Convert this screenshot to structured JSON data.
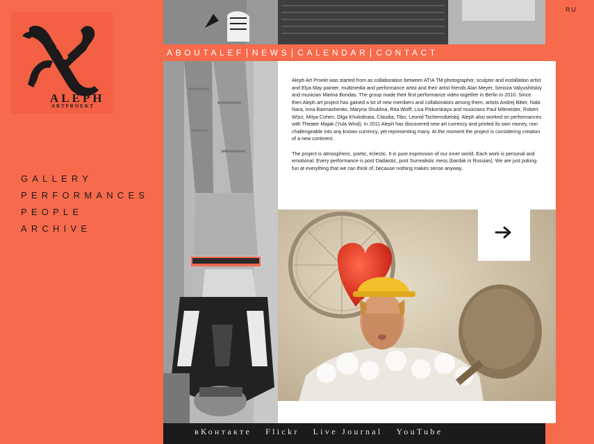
{
  "logo": {
    "word": "ALEPH",
    "sub": "ARTPROEKT"
  },
  "lang": "RU",
  "side_nav": {
    "items": [
      {
        "label": "Gallery"
      },
      {
        "label": "Performances"
      },
      {
        "label": "People"
      },
      {
        "label": "Archive"
      }
    ]
  },
  "top_nav": {
    "items": [
      {
        "label": "AboutAlef"
      },
      {
        "label": "News"
      },
      {
        "label": "Calendar"
      },
      {
        "label": "Contact"
      }
    ]
  },
  "article": {
    "paragraph1": "Aleph Art Proekt was started from as collaboration between ATIA TM photographer, sculptor and installation artist and Elya May painter, multimedia and performance artist and their artist friends Alan Meyer, Serioza Valyushitskiy and musician Marina Bondas. The group made their first performance video together in Berlin in 2010. Since then Aleph art project has gained a lot of new members and collaborators among them, artists Andrej Bitter, Nabi Nara, Inna Barmashenko, Maryna Shuklina, Rita Wolff, Lisa Piskorskaya and musicians Paul Milmeister, Robert Würz, Mitya Cohen, Olga Kholodnaia, Claudia, Tibo, Leonid Tschernobelskij. Aleph also worked on performances with Theater Majak (Yula Wind). In 2011 Aleph has discovered new art currency and printed its own money, non challengeable into any known currency, yet representing many. At the moment the project is considering creation of a new continent.",
    "paragraph2": "The project is atmospheric, poetic, eclectic. It is pure expression of our inner world. Each work is personal and emotional. Every performance is post Dadaistic, post Surrealistic mess (bardak in Russian). We are just poking fun at everything that we can think of, because nothing makes sense anyway."
  },
  "footer": {
    "links": [
      {
        "label": "вКонтакте"
      },
      {
        "label": "Flickr"
      },
      {
        "label": "Live Journal"
      },
      {
        "label": "YouTube"
      }
    ]
  },
  "colors": {
    "background": "#f76a4c",
    "footer": "#1b1a1d",
    "panel": "#ffffff"
  },
  "icons": {
    "next": "arrow-right-icon"
  }
}
